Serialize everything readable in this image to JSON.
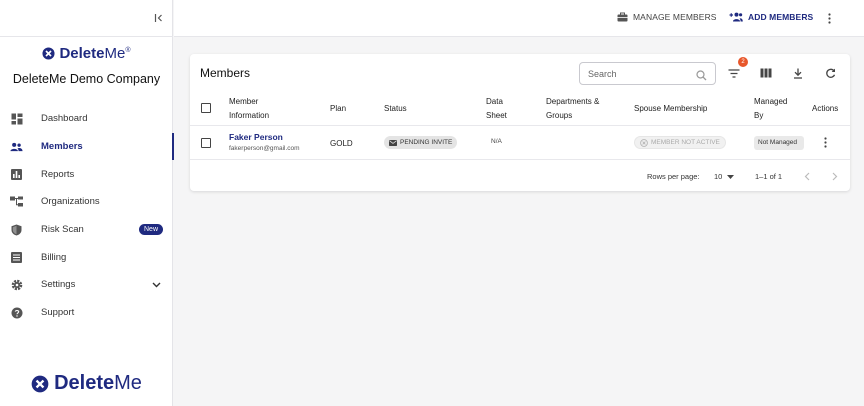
{
  "sidebar": {
    "brand_top": {
      "delete": "Delete",
      "me": "Me",
      "tm": "®"
    },
    "company": "DeleteMe Demo Company",
    "items": [
      {
        "label": "Dashboard"
      },
      {
        "label": "Members"
      },
      {
        "label": "Reports"
      },
      {
        "label": "Organizations"
      },
      {
        "label": "Risk Scan",
        "badge": "New"
      },
      {
        "label": "Billing"
      },
      {
        "label": "Settings"
      },
      {
        "label": "Support"
      }
    ],
    "brand_bottom": {
      "delete": "Delete",
      "me": "Me"
    }
  },
  "topbar": {
    "manage_members": "MANAGE MEMBERS",
    "add_members": "ADD MEMBERS"
  },
  "members": {
    "title": "Members",
    "search_placeholder": "Search",
    "filter_count": "2",
    "columns": [
      "Member Information",
      "Plan",
      "Status",
      "Data Sheet",
      "Departments & Groups",
      "Spouse Membership",
      "Managed By",
      "Actions"
    ],
    "rows": [
      {
        "name": "Faker Person",
        "email": "fakerperson@gmail.com",
        "plan": "GOLD",
        "status": "PENDING INVITE",
        "data_sheet": "N/A",
        "spouse": "MEMBER NOT ACTIVE",
        "managed_by": "Not Managed"
      }
    ],
    "footer": {
      "rows_per_page_label": "Rows per page:",
      "rows_per_page_value": "10",
      "range": "1–1 of 1"
    }
  },
  "colors": {
    "brand": "#1f2a80",
    "badge": "#e8572b"
  }
}
